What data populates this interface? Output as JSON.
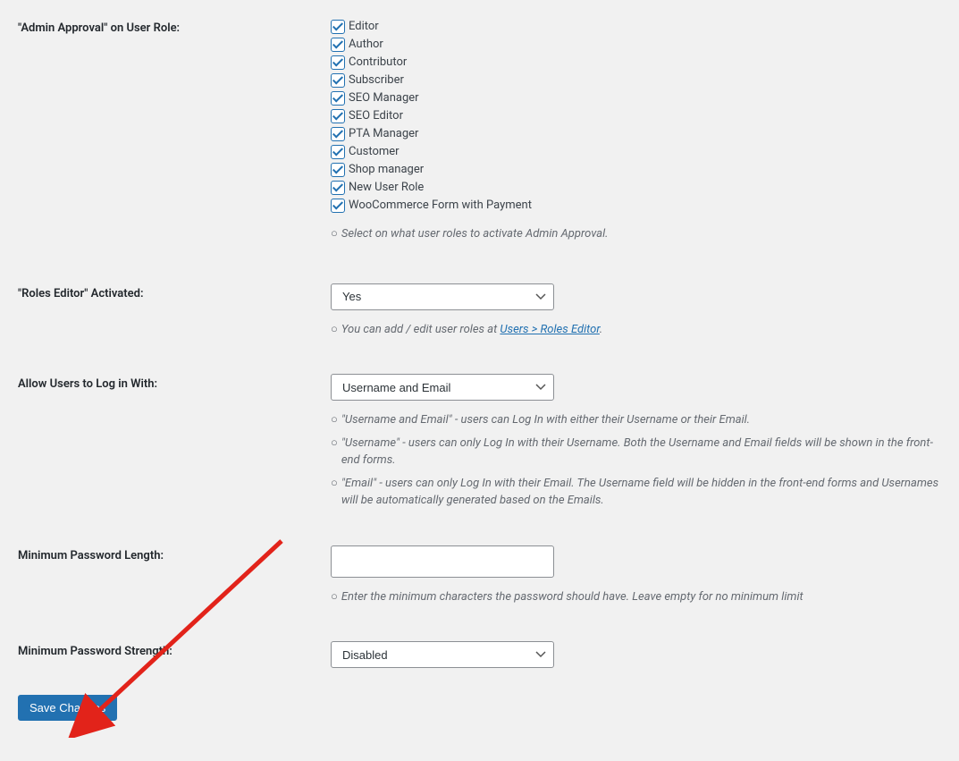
{
  "admin_approval": {
    "label": "\"Admin Approval\" on User Role:",
    "roles": [
      {
        "label": "Editor",
        "checked": true
      },
      {
        "label": "Author",
        "checked": true
      },
      {
        "label": "Contributor",
        "checked": true
      },
      {
        "label": "Subscriber",
        "checked": true
      },
      {
        "label": "SEO Manager",
        "checked": true
      },
      {
        "label": "SEO Editor",
        "checked": true
      },
      {
        "label": "PTA Manager",
        "checked": true
      },
      {
        "label": "Customer",
        "checked": true
      },
      {
        "label": "Shop manager",
        "checked": true
      },
      {
        "label": "New User Role",
        "checked": true
      },
      {
        "label": "WooCommerce Form with Payment",
        "checked": true
      }
    ],
    "description": "Select on what user roles to activate Admin Approval."
  },
  "roles_editor": {
    "label": "\"Roles Editor\" Activated:",
    "selected": "Yes",
    "description_prefix": "You can add / edit user roles at ",
    "link_text": "Users > Roles Editor",
    "description_suffix": "."
  },
  "login_with": {
    "label": "Allow Users to Log in With:",
    "selected": "Username and Email",
    "descriptions": [
      "\"Username and Email\" - users can Log In with either their Username or their Email.",
      "\"Username\" - users can only Log In with their Username. Both the Username and Email fields will be shown in the front-end forms.",
      "\"Email\" - users can only Log In with their Email. The Username field will be hidden in the front-end forms and Usernames will be automatically generated based on the Emails."
    ]
  },
  "min_password_length": {
    "label": "Minimum Password Length:",
    "value": "",
    "description": "Enter the minimum characters the password should have. Leave empty for no minimum limit"
  },
  "min_password_strength": {
    "label": "Minimum Password Strength:",
    "selected": "Disabled"
  },
  "save_button": "Save Changes"
}
